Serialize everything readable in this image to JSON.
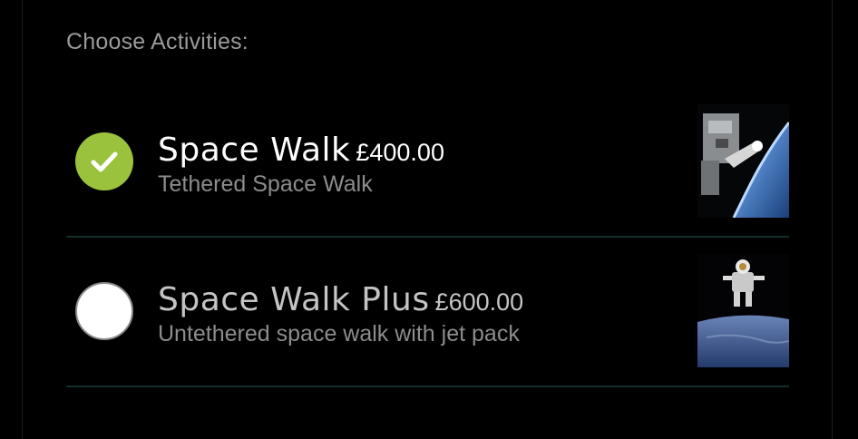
{
  "section_title": "Choose Activities:",
  "activities": [
    {
      "name": "Space Walk",
      "price": "£400.00",
      "description": "Tethered Space Walk",
      "selected": true,
      "image_icon": "spacewalk-earth-image"
    },
    {
      "name": "Space Walk Plus",
      "price": "£600.00",
      "description": "Untethered space walk with jet pack",
      "selected": false,
      "image_icon": "astronaut-jetpack-image"
    }
  ],
  "colors": {
    "background": "#000000",
    "accent_check": "#9bc23c",
    "divider": "#12302c",
    "muted_text": "#8c8c8c"
  }
}
